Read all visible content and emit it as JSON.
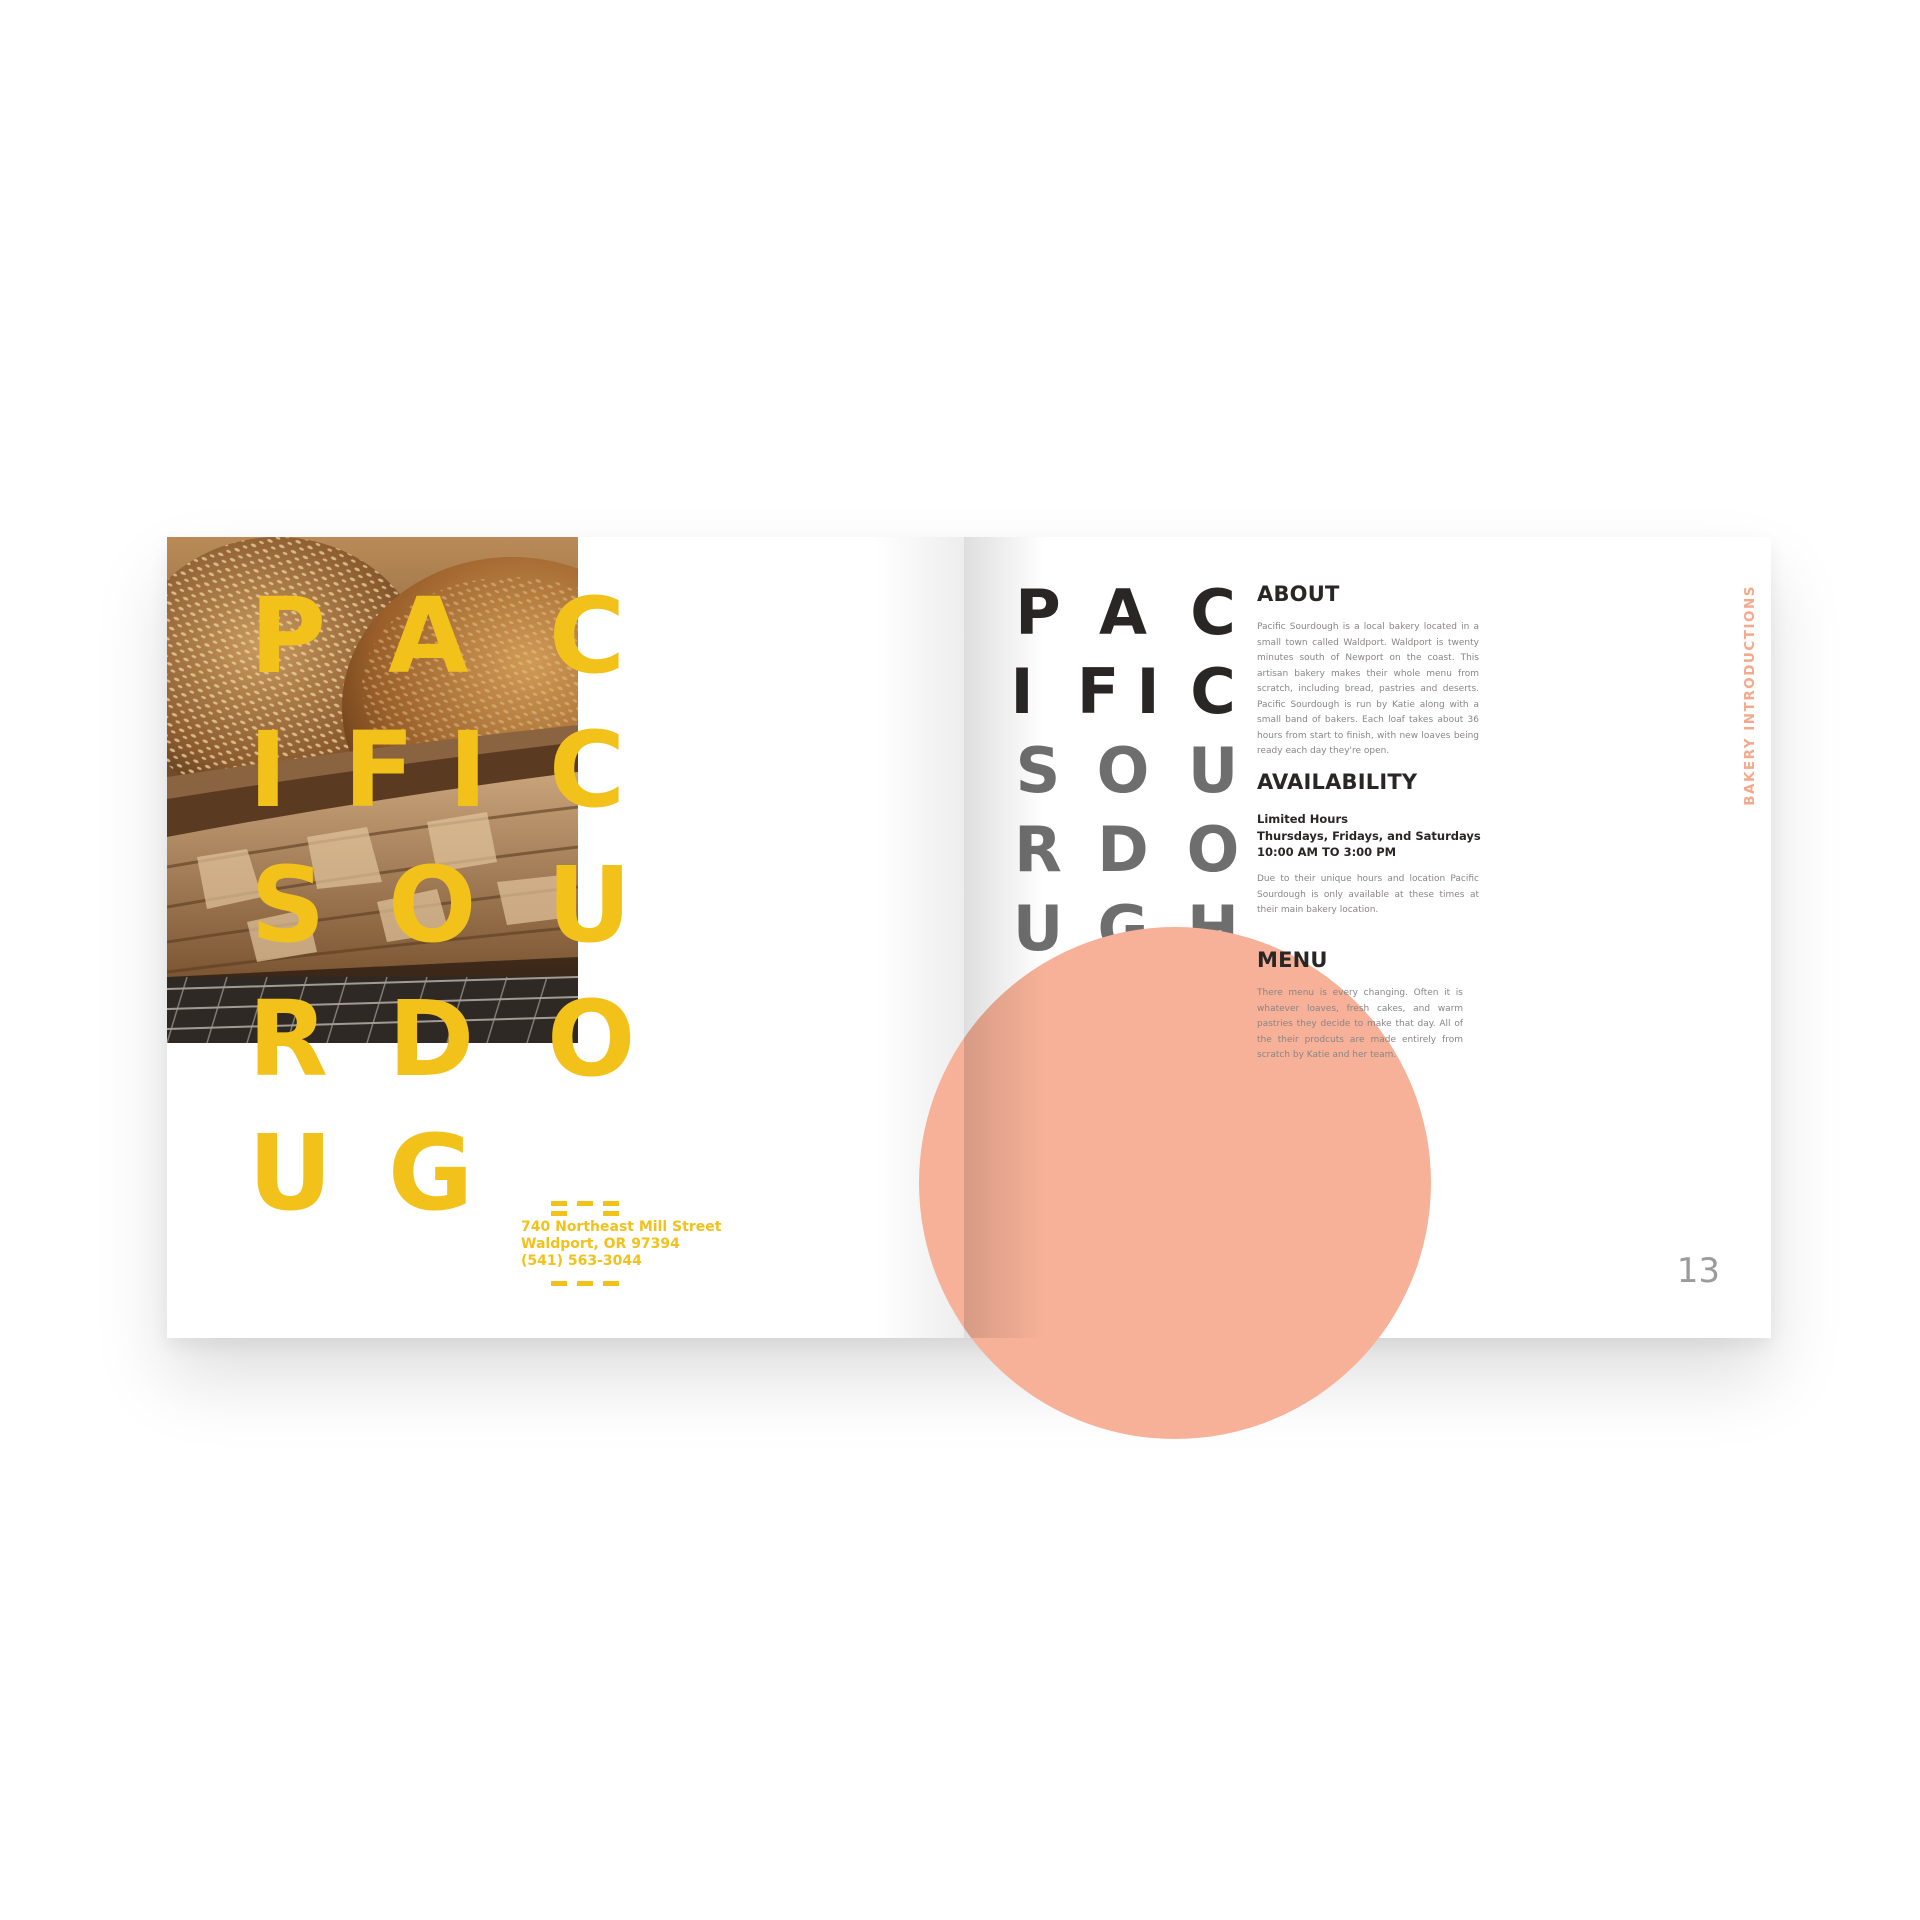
{
  "left_page": {
    "title_rows": [
      [
        "P",
        "A",
        "C"
      ],
      [
        "I",
        "F",
        "I",
        "C"
      ],
      [
        "S",
        "O",
        "U"
      ],
      [
        "R",
        "D",
        "O"
      ],
      [
        "U",
        "G"
      ]
    ],
    "address": {
      "street": "740 Northeast Mill Street",
      "city": "Waldport, OR 97394",
      "phone": "(541) 563-3044"
    },
    "accent_color": "#F2C21B",
    "photo_icon": "bread-basket-photo"
  },
  "right_page": {
    "title_rows": [
      [
        "P",
        "A",
        "C"
      ],
      [
        "I",
        "F",
        "I",
        "C"
      ],
      [
        "S",
        "O",
        "U"
      ],
      [
        "R",
        "D",
        "O"
      ],
      [
        "U",
        "G",
        "H"
      ]
    ],
    "about": {
      "heading": "ABOUT",
      "body": "Pacific Sourdough is a local bakery located in a small town called Waldport. Waldport is twenty minutes south of Newport on the coast. This artisan bakery makes their whole menu from scratch, including bread, pastries and deserts. Pacific Sourdough is run by Katie along with a small band of bakers. Each loaf takes about 36 hours from start to finish, with new loaves being ready each day they're open."
    },
    "availability": {
      "heading": "AVAILABILITY",
      "hours_title": "Limited Hours",
      "days": "Thursdays, Fridays, and Saturdays",
      "time": "10:00 AM TO 3:00 PM",
      "body": "Due to their unique hours and location Pacific Sourdough is only available at these times at their main bakery location."
    },
    "menu": {
      "heading": "MENU",
      "body": "There menu is every changing. Often it is whatever loaves, fresh cakes, and warm pastries they decide to make that day. All of the their prodcuts are made entirely from scratch by Katie and her team."
    },
    "side_label": "BAKERY  INTRODUCTIONS",
    "page_number": "13",
    "accent_color": "#F7B198",
    "text_color": "#2a2626"
  }
}
